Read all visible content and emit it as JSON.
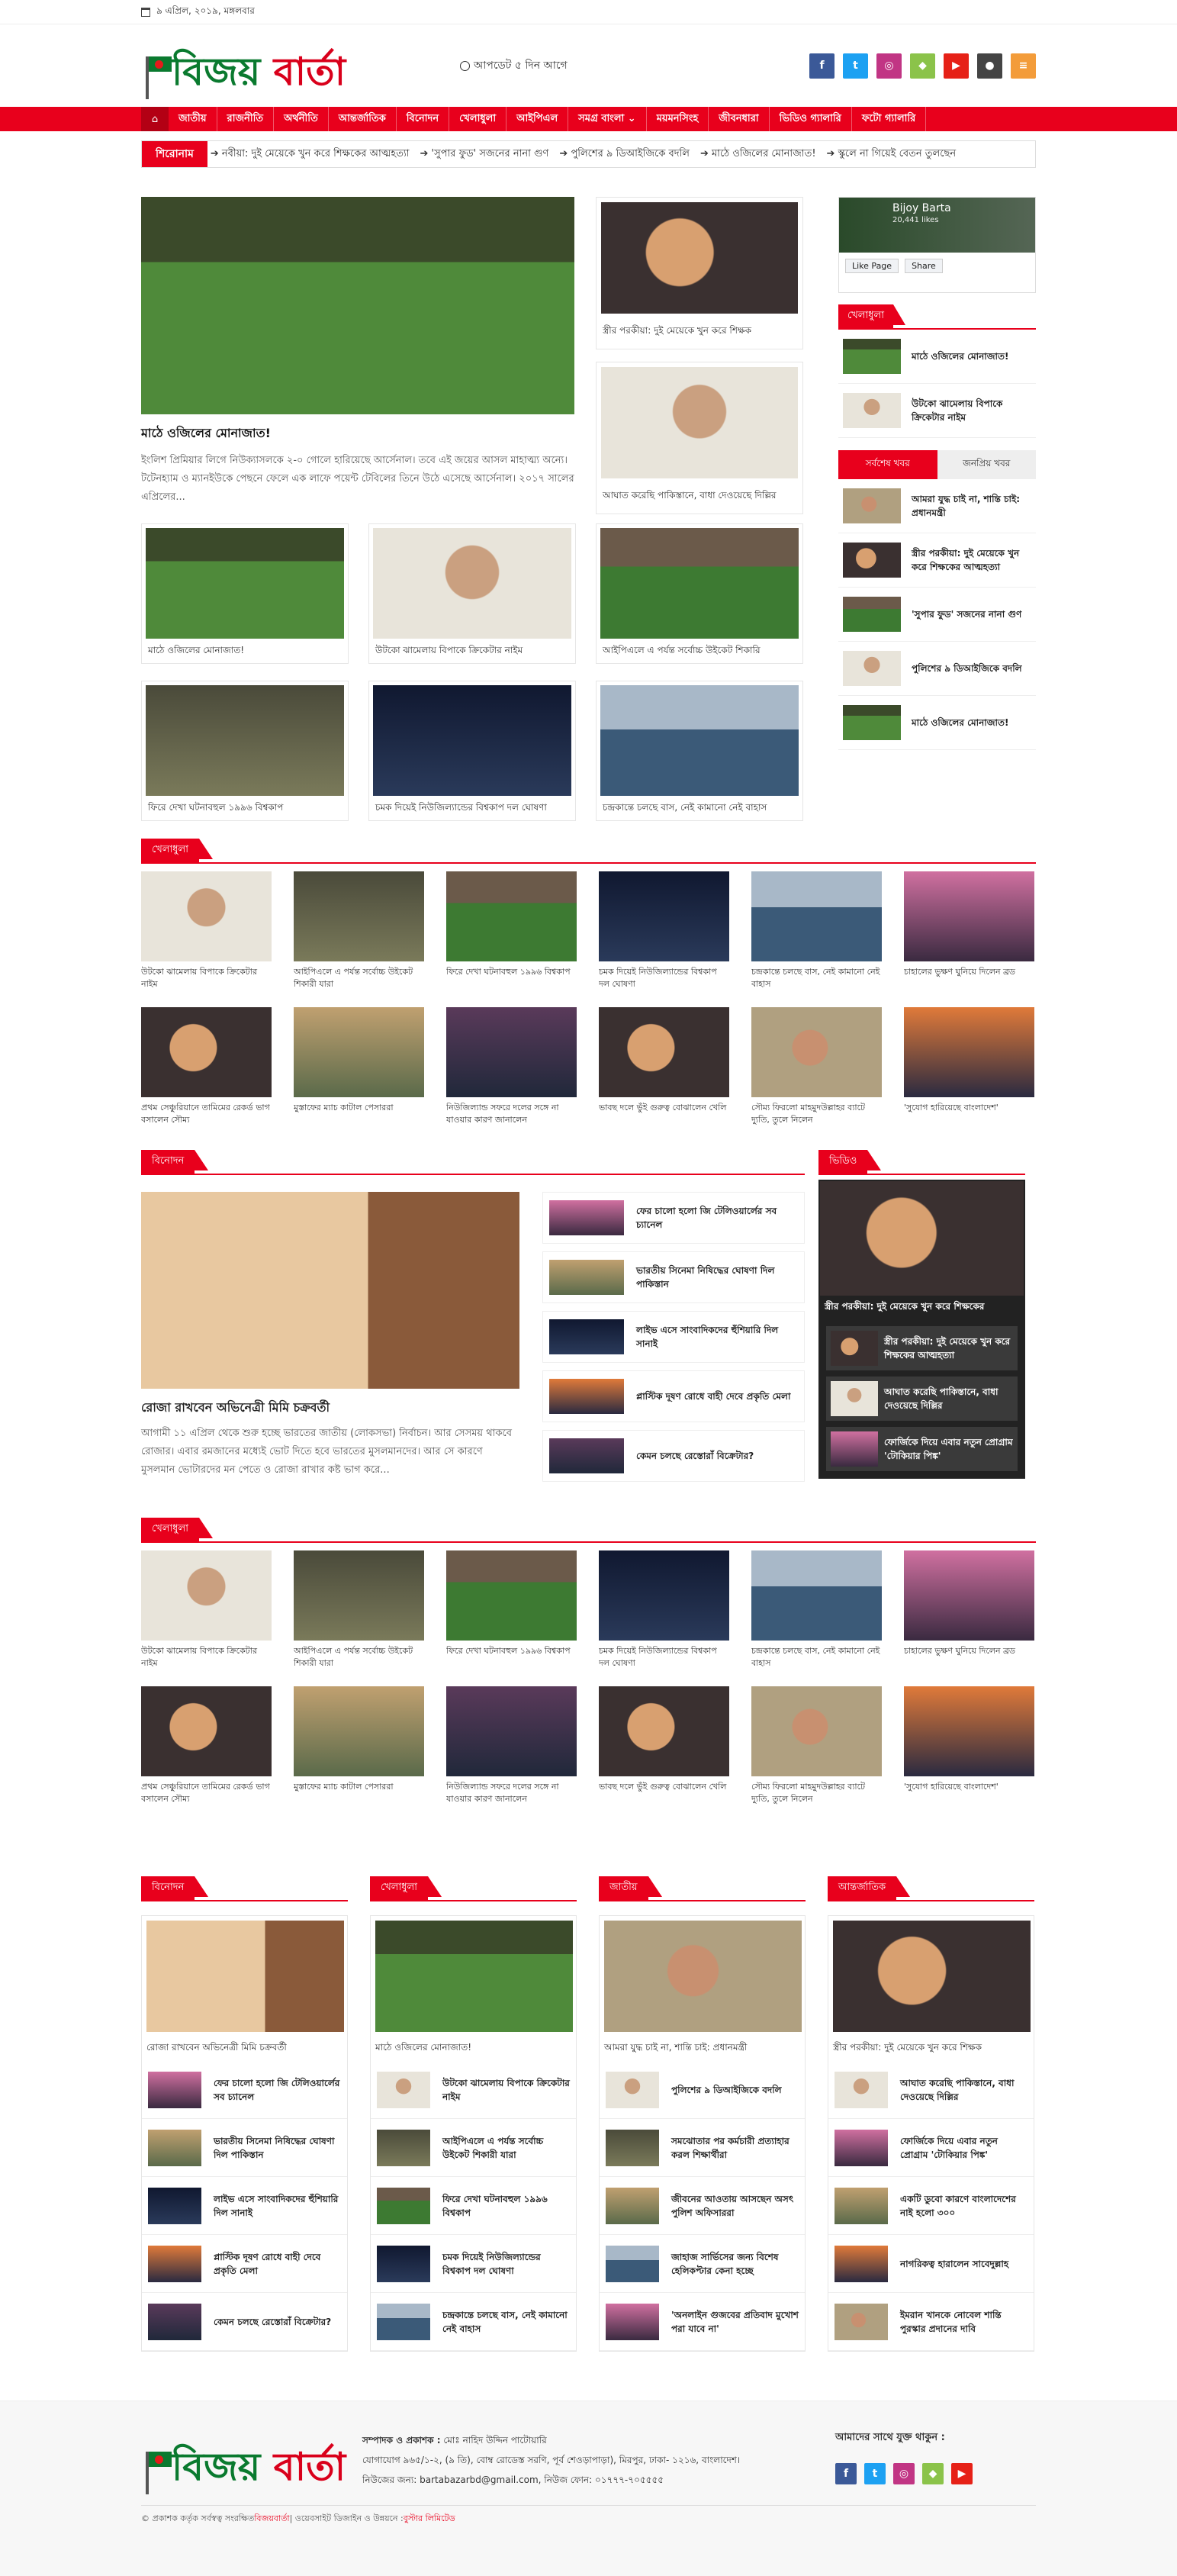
{
  "topbar": {
    "date": "৯ এপ্রিল, ২০১৯, মঙ্গলবার"
  },
  "header": {
    "logo_part1": "বিজয়",
    "logo_part2": " বার্তা",
    "updated": "আপডেট ৫ দিন আগে",
    "socials": [
      {
        "icon": "facebook-icon",
        "glyph": "f",
        "color": "#3b5998"
      },
      {
        "icon": "twitter-icon",
        "glyph": "t",
        "color": "#1da1f2"
      },
      {
        "icon": "instagram-icon",
        "glyph": "◎",
        "color": "#c13584"
      },
      {
        "icon": "vine-icon",
        "glyph": "◆",
        "color": "#8bc34a"
      },
      {
        "icon": "youtube-icon",
        "glyph": "▶",
        "color": "#e62117"
      },
      {
        "icon": "apple-icon",
        "glyph": "●",
        "color": "#444444"
      },
      {
        "icon": "rss-icon",
        "glyph": "≡",
        "color": "#f39c3a"
      }
    ]
  },
  "nav": {
    "items": [
      "জাতীয়",
      "রাজনীতি",
      "অর্থনীতি",
      "আন্তর্জাতিক",
      "বিনোদন",
      "খেলাধুলা",
      "আইপিএল",
      "সমগ্র বাংলা ⌄",
      "ময়মনসিংহ",
      "জীবনধারা",
      "ভিডিও গ্যালারি",
      "ফটো গ্যালারি"
    ]
  },
  "ticker": {
    "label": "শিরোনাম",
    "items": [
      "নবীয়া: দুই মেয়েকে খুন করে শিক্ষকের আত্মহত্যা",
      "'সুপার ফুড' সজনের নানা গুণ",
      "পুলিশের ৯ ডিআইজিকে বদলি",
      "মাঠে ওজিলের মোনাজাত!",
      "স্কুলে না গিয়েই বেতন তুলছেন"
    ]
  },
  "lead": {
    "title": "মাঠে ওজিলের মোনাজাত!",
    "excerpt": "ইংলিশ প্রিমিয়ার লিগে নিউক্যাসলকে ২-০ গোলে হারিয়েছে আর্সেনাল। তবে এই জয়ের আসল মাহাত্ম্য অন্যে। টটেনহ্যাম ও ম্যানইউকে পেছনে ফেলে এক লাফে পয়েন্ট টেবিলের তিনে উঠে এসেছে আর্সেনাল। ২০১৭ সালের এপ্রিলের..."
  },
  "grid3": [
    "মাঠে ওজিলের মোনাজাত!",
    "উটকো ঝামেলায় বিপাকে ক্রিকেটার নাইম",
    "আইপিএলে এ পর্যন্ত সর্বোচ্চ উইকেট শিকারি",
    "ফিরে দেখা ঘটনাবহুল ১৯৯৬ বিশ্বকাপ",
    "চমক দিয়েই নিউজিল্যান্ডের বিশ্বকাপ দল ঘোষণা",
    "চন্দ্রকান্তে চলছে বাস, নেই কামানো নেই বাহাস"
  ],
  "midcol": [
    "স্ত্রীর পরকীয়া: দুই মেয়েকে খুন করে শিক্ষক",
    "আঘাত করেছি পাকিস্তানে, বাধা দেওয়েছে দিল্লির"
  ],
  "side": {
    "fb_name": "Bijoy Barta",
    "fb_likes": "20,441 likes",
    "fb_like_btn": "Like Page",
    "fb_share_btn": "Share",
    "sports_head": "খেলাধুলা",
    "sports": [
      "মাঠে ওজিলের মোনাজাত!",
      "উটকো ঝামেলায় বিপাকে ক্রিকেটার নাইম"
    ],
    "tab_latest": "সর্বশেষ খবর",
    "tab_popular": "জনপ্রিয় খবর",
    "latest": [
      "আমরা যুদ্ধ চাই না, শান্তি চাই: প্রধানমন্ত্রী",
      "স্ত্রীর পরকীয়া: দুই মেয়েকে খুন করে শিক্ষকের আত্মহত্যা",
      "'সুপার ফুড' সজনের নানা গুণ",
      "পুলিশের ৯ ডিআইজিকে বদলি",
      "মাঠে ওজিলের মোনাজাত!"
    ]
  },
  "sports1": {
    "head": "খেলাধুলা",
    "items": [
      "উটকো ঝামেলায় বিপাকে ক্রিকেটার নাইম",
      "আইপিএলে এ পর্যন্ত সর্বোচ্চ উইকেট শিকারী যারা",
      "ফিরে দেখা ঘটনাবহুল ১৯৯৬ বিশ্বকাপ",
      "চমক দিয়েই নিউজিল্যান্ডের বিশ্বকাপ দল ঘোষণা",
      "চন্দ্রকান্তে চলছে বাস, নেই কামানো নেই বাহাস",
      "চাহালের ভুক্ষণ ঘুনিয়ে দিলেন ব্রড",
      "প্রথম সেঞ্চুরিয়ানে তামিমের রেকর্ড ভাগ বসালেন সৌম্য",
      "মুস্তাফের ম্যাচ কাটাল পেসাররা",
      "নিউজিল্যান্ড সফরে দলের সঙ্গে না যাওয়ার কারণ জানালেন",
      "ভাবছ দলে ভুঁই গুরুত্ব বোঝালেন খেলি",
      "সৌম্য ফিরলো মাহমুদউল্লাহর ব্যাটে দ্যুতি, তুলে নিলেন",
      "'সুযোগ হারিয়েছে বাংলাদেশ'"
    ]
  },
  "ent": {
    "head": "বিনোদন",
    "lead_title": "রোজা রাখবেন অভিনেত্রী মিমি চক্রবর্তী",
    "lead_excerpt": "আগামী ১১ এপ্রিল থেকে শুরু হচ্ছে ভারতের জাতীয় (লোকসভা) নির্বাচন। আর সেসময় থাকবে রোজার। এবার রমজানের মধ্যেই ভোট দিতে হবে ভারতের মুসলমানদের। আর সে কারণে মুসলমান ভোটারদের মন পেতে ও রোজা রাখার কষ্ট ভাগ করে...",
    "list": [
      "ফের চালো হলো জি টেলিওয়ার্লের সব চ্যানেল",
      "ভারতীয় সিনেমা নিষিদ্ধের ঘোষণা দিল পাকিস্তান",
      "লাইভ এসে সাংবাদিকদের হুঁশিয়ারি দিল সানাই",
      "প্লাস্টিক দূষণ রোধে বাহী দেবে প্রকৃতি মেলা",
      "কেমন চলছে রেস্তোরাঁ বিক্রেটার?"
    ]
  },
  "video": {
    "head": "ভিডিও",
    "main_title": "স্ত্রীর পরকীয়া: দুই মেয়েকে খুন করে শিক্ষকের",
    "list": [
      "স্ত্রীর পরকীয়া: দুই মেয়েকে খুন করে শিক্ষকের আত্মহত্যা",
      "আঘাত করেছি পাকিস্তানে, বাধা দেওয়েছে দিল্লির",
      "ফোর্জিকে দিয়ে এবার নতুন প্রোগ্রাম 'টোকিয়ার পিঙ্ক'"
    ]
  },
  "sports2": {
    "head": "খেলাধুলা",
    "items": [
      "উটকো ঝামেলায় বিপাকে ক্রিকেটার নাইম",
      "আইপিএলে এ পর্যন্ত সর্বোচ্চ উইকেট শিকারী যারা",
      "ফিরে দেখা ঘটনাবহুল ১৯৯৬ বিশ্বকাপ",
      "চমক দিয়েই নিউজিল্যান্ডের বিশ্বকাপ দল ঘোষণা",
      "চন্দ্রকান্তে চলছে বাস, নেই কামানো নেই বাহাস",
      "চাহালের ভুক্ষণ ঘুনিয়ে দিলেন ব্রড",
      "প্রথম সেঞ্চুরিয়ানে তামিমের রেকর্ড ভাগ বসালেন সৌম্য",
      "মুস্তাফের ম্যাচ কাটাল পেসাররা",
      "নিউজিল্যান্ড সফরে দলের সঙ্গে না যাওয়ার কারণ জানালেন",
      "ভাবছ দলে ভুঁই গুরুত্ব বোঝালেন খেলি",
      "সৌম্য ফিরলো মাহমুদউল্লাহর ব্যাটে দ্যুতি, তুলে নিলেন",
      "'সুযোগ হারিয়েছে বাংলাদেশ'"
    ]
  },
  "four": [
    {
      "head": "বিনোদন",
      "cap": "রোজা রাখবেন অভিনেত্রী মিমি চক্রবর্তী",
      "list": [
        "ফের চালো হলো জি টেলিওয়ার্লের সব চ্যানেল",
        "ভারতীয় সিনেমা নিষিদ্ধের ঘোষণা দিল পাকিস্তান",
        "লাইভ এসে সাংবাদিকদের হুঁশিয়ারি দিল সানাই",
        "প্লাস্টিক দূষণ রোধে বাহী দেবে প্রকৃতি মেলা",
        "কেমন চলছে রেস্তোরাঁ বিক্রেটার?"
      ]
    },
    {
      "head": "খেলাধুলা",
      "cap": "মাঠে ওজিলের মোনাজাত!",
      "list": [
        "উটকো ঝামেলায় বিপাকে ক্রিকেটার নাইম",
        "আইপিএলে এ পর্যন্ত সর্বোচ্চ উইকেট শিকারী যারা",
        "ফিরে দেখা ঘটনাবহুল ১৯৯৬ বিশ্বকাপ",
        "চমক দিয়েই নিউজিল্যান্ডের বিশ্বকাপ দল ঘোষণা",
        "চন্দ্রকান্তে চলছে বাস, নেই কামানো নেই বাহাস"
      ]
    },
    {
      "head": "জাতীয়",
      "cap": "আমরা যুদ্ধ চাই না, শান্তি চাই: প্রধানমন্ত্রী",
      "list": [
        "পুলিশের ৯ ডিআইজিকে বদলি",
        "সমঝোতার পর কর্মচারী প্রত্যাহার করল শিক্ষার্থীরা",
        "জীবনের আওতায় আসছেন অসৎ পুলিশ অফিসাররা",
        "জাহাজ সার্ভিসের জন্য বিশেষ হেলিকপ্টার কেনা হচ্ছে",
        "'অনলাইন গুজবের প্রতিবাদ মুখোশ পরা যাবে না'"
      ]
    },
    {
      "head": "আন্তর্জাতিক",
      "cap": "স্ত্রীর পরকীয়া: দুই মেয়েকে খুন করে শিক্ষক",
      "list": [
        "আঘাত করেছি পাকিস্তানে, বাধা দেওয়েছে দিল্লির",
        "ফোর্জিকে দিয়ে এবার নতুন প্রোগ্রাম 'টোকিয়ার পিঙ্ক'",
        "একটি ডুবো কারণে বাংলাদেশের নাই হলো ৩০০",
        "নাগরিকত্ব হারালেন সাবেদুল্লাহ",
        "ইমরান খানকে নোবেল শান্তি পুরস্কার প্রদানের দাবি"
      ]
    }
  ],
  "footer": {
    "editor_label": "সম্পাদক ও প্রকাশক :",
    "editor": "মোঃ নাহিদ উদ্দিন পাটোয়ারি",
    "address": "যোগাযোগ ৯৬৫/১-২, (৯ তি), বোম্ব রোডেস্ত সরণি, পূর্ব শেওড়াপাড়া), মিরপুর, ঢাকা- ১২১৬, বাংলাদেশ।",
    "contact": "নিউজের জন্য: bartabazarbd@gmail.com, নিউজ ফোন: ০১৭৭৭-৭০৫৫৫৫",
    "social_title": "আমাদের সাথে যুক্ত থাকুন :",
    "copy_a": "© প্রকাশক কর্তৃক সর্বস্বত্ব সংরক্ষিত",
    "copy_b": "বিজয়বার্তা",
    "copy_c": " | ওয়েবসাইট ডিজাইন ও উন্নয়নে : ",
    "copy_d": "বুস্টার লিমিটেড"
  }
}
